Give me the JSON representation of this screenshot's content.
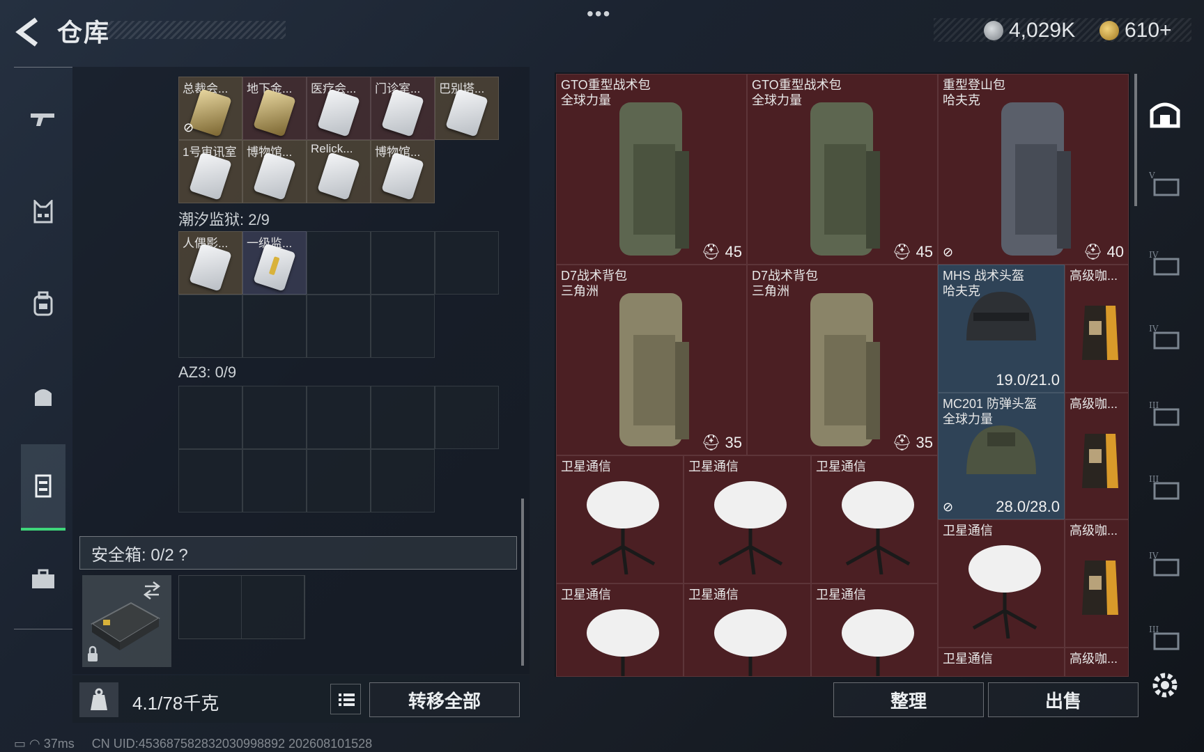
{
  "header": {
    "title": "仓库",
    "currency_silver": "4,029K",
    "currency_gold": "610+",
    "menu_dots": "•••"
  },
  "left_nav": [
    {
      "icon": "gun-icon"
    },
    {
      "icon": "armor-vest-icon"
    },
    {
      "icon": "backpack-icon"
    },
    {
      "icon": "helmet-bag-icon"
    },
    {
      "icon": "chest-rig-icon"
    },
    {
      "icon": "briefcase-icon"
    }
  ],
  "container": {
    "keys_row1": [
      "总裁会...",
      "地下金...",
      "医疗会...",
      "门诊室...",
      "巴别塔..."
    ],
    "keys_row2": [
      "1号审讯室",
      "博物馆...",
      "Relick...",
      "博物馆..."
    ],
    "section2_label": "潮汐监狱: 2/9",
    "section2_items": [
      "人偶影...",
      "一级监..."
    ],
    "section3_label": "AZ3: 0/9"
  },
  "safe_box": {
    "label": "安全箱: 0/2 ?"
  },
  "weight": {
    "value": "4.1/78千克"
  },
  "buttons": {
    "transfer": "转移全部",
    "sort": "整理",
    "sell": "出售"
  },
  "stash": {
    "backpacks": [
      {
        "name1": "GTO重型战术包",
        "name2": "全球力量",
        "value": "45"
      },
      {
        "name1": "GTO重型战术包",
        "name2": "全球力量",
        "value": "45"
      },
      {
        "name1": "重型登山包",
        "name2": "哈夫克",
        "value": "40"
      },
      {
        "name1": "D7战术背包",
        "name2": "三角洲",
        "value": "35"
      },
      {
        "name1": "D7战术背包",
        "name2": "三角洲",
        "value": "35"
      }
    ],
    "helmets": [
      {
        "name1": "MHS 战术头盔",
        "name2": "哈夫克",
        "value": "19.0/21.0"
      },
      {
        "name1": "MC201 防弹头盔",
        "name2": "全球力量",
        "value": "28.0/28.0"
      }
    ],
    "coffee_label": "高级咖...",
    "satellite_label": "卫星通信"
  },
  "status": {
    "ping": "37ms",
    "uid": "CN UID:453687582832030998892 202608101528"
  }
}
